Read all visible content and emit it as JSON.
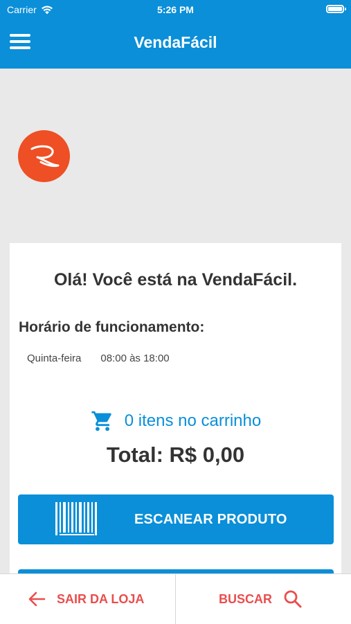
{
  "status_bar": {
    "carrier": "Carrier",
    "time": "5:26 PM"
  },
  "nav": {
    "title": "VendaFácil",
    "menu_icon": "hamburger-menu-icon"
  },
  "store": {
    "logo_icon": "store-logo"
  },
  "card": {
    "welcome": "Olá! Você está na VendaFácil.",
    "hours_title": "Horário de funcionamento:",
    "hours": [
      {
        "day": "Quinta-feira",
        "time": "08:00 às 18:00"
      }
    ],
    "cart_text": "0 itens no carrinho",
    "total": "Total: R$ 0,00",
    "scan_button": "ESCANEAR PRODUTO"
  },
  "bottom_bar": {
    "exit_label": "SAIR DA LOJA",
    "search_label": "BUSCAR"
  },
  "colors": {
    "primary": "#0a8fd8",
    "accent_red": "#ea4d4d",
    "logo_orange": "#ee4f24"
  }
}
